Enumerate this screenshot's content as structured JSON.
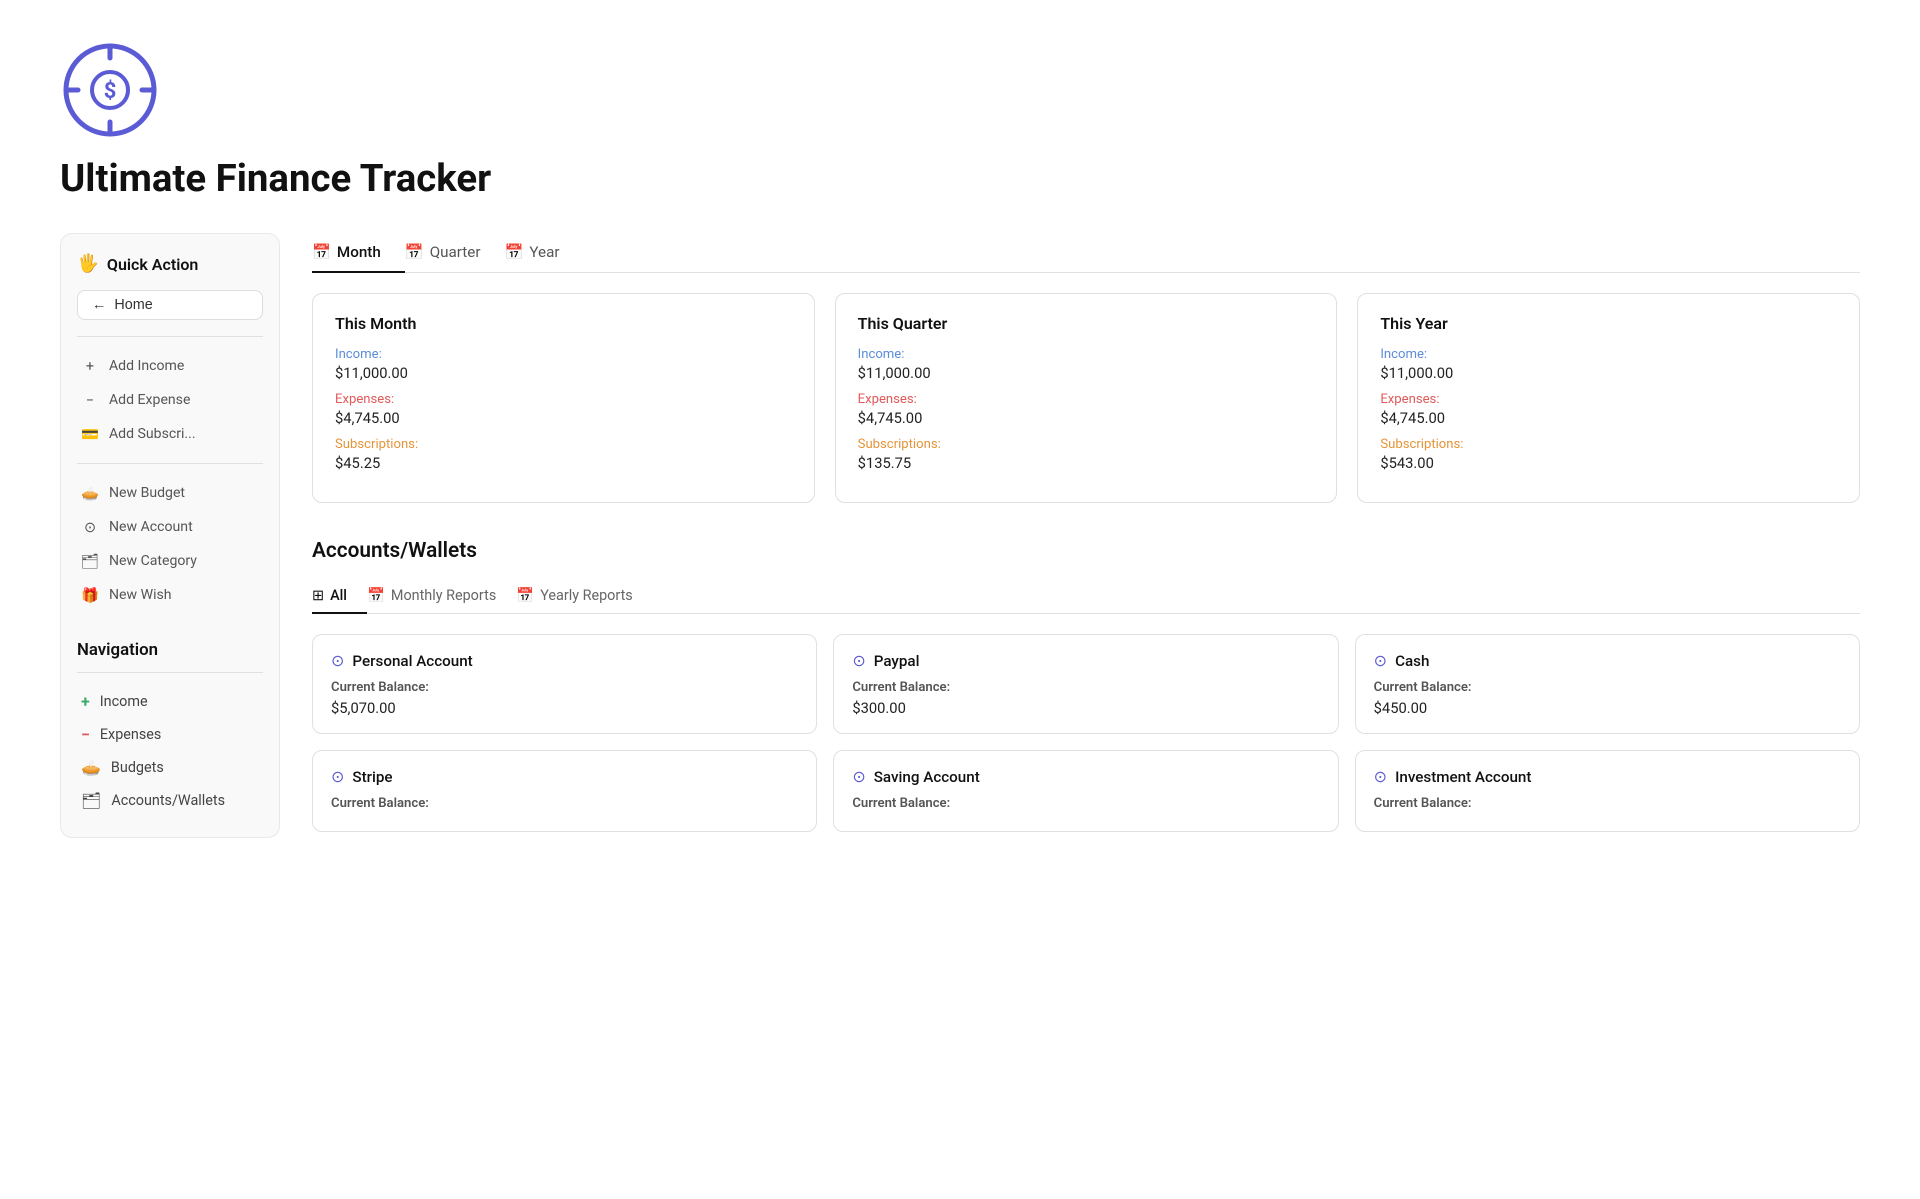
{
  "app": {
    "title": "Ultimate Finance Tracker"
  },
  "sidebar": {
    "header": "Quick Action",
    "home_label": "Home",
    "actions": [
      {
        "id": "add-income",
        "label": "Add Income",
        "icon": "+"
      },
      {
        "id": "add-expense",
        "label": "Add Expense",
        "icon": "−"
      },
      {
        "id": "add-subscription",
        "label": "Add Subscri...",
        "icon": "💳"
      },
      {
        "id": "new-budget",
        "label": "New Budget",
        "icon": "🥧"
      },
      {
        "id": "new-account",
        "label": "New Account",
        "icon": "⊙"
      },
      {
        "id": "new-category",
        "label": "New Category",
        "icon": "🗂"
      },
      {
        "id": "new-wish",
        "label": "New Wish",
        "icon": "🎁"
      }
    ]
  },
  "navigation": {
    "title": "Navigation",
    "items": [
      {
        "id": "income",
        "label": "Income",
        "icon": "+"
      },
      {
        "id": "expenses",
        "label": "Expenses",
        "icon": "−"
      },
      {
        "id": "budgets",
        "label": "Budgets",
        "icon": "🥧"
      },
      {
        "id": "accounts-wallets",
        "label": "Accounts/Wallets",
        "icon": "🗂"
      }
    ]
  },
  "period_tabs": [
    {
      "id": "month",
      "label": "Month",
      "active": true
    },
    {
      "id": "quarter",
      "label": "Quarter",
      "active": false
    },
    {
      "id": "year",
      "label": "Year",
      "active": false
    }
  ],
  "period_cards": [
    {
      "id": "this-month",
      "title": "This Month",
      "income_label": "Income:",
      "income_value": "$11,000.00",
      "expenses_label": "Expenses:",
      "expenses_value": "$4,745.00",
      "subscriptions_label": "Subscriptions:",
      "subscriptions_value": "$45.25"
    },
    {
      "id": "this-quarter",
      "title": "This Quarter",
      "income_label": "Income:",
      "income_value": "$11,000.00",
      "expenses_label": "Expenses:",
      "expenses_value": "$4,745.00",
      "subscriptions_label": "Subscriptions:",
      "subscriptions_value": "$135.75"
    },
    {
      "id": "this-year",
      "title": "This Year",
      "income_label": "Income:",
      "income_value": "$11,000.00",
      "expenses_label": "Expenses:",
      "expenses_value": "$4,745.00",
      "subscriptions_label": "Subscriptions:",
      "subscriptions_value": "$543.00"
    }
  ],
  "accounts_section": {
    "title": "Accounts/Wallets",
    "tabs": [
      {
        "id": "all",
        "label": "All",
        "active": true,
        "icon": "grid"
      },
      {
        "id": "monthly-reports",
        "label": "Monthly Reports",
        "active": false,
        "icon": "calendar"
      },
      {
        "id": "yearly-reports",
        "label": "Yearly Reports",
        "active": false,
        "icon": "calendar"
      }
    ],
    "accounts": [
      {
        "id": "personal-account",
        "name": "Personal Account",
        "balance_label": "Current Balance:",
        "balance_value": "$5,070.00"
      },
      {
        "id": "paypal",
        "name": "Paypal",
        "balance_label": "Current Balance:",
        "balance_value": "$300.00"
      },
      {
        "id": "cash",
        "name": "Cash",
        "balance_label": "Current Balance:",
        "balance_value": "$450.00"
      },
      {
        "id": "stripe",
        "name": "Stripe",
        "balance_label": "Current Balance:",
        "balance_value": ""
      },
      {
        "id": "saving-account",
        "name": "Saving Account",
        "balance_label": "Current Balance:",
        "balance_value": ""
      },
      {
        "id": "investment-account",
        "name": "Investment Account",
        "balance_label": "Current Balance:",
        "balance_value": ""
      }
    ]
  }
}
